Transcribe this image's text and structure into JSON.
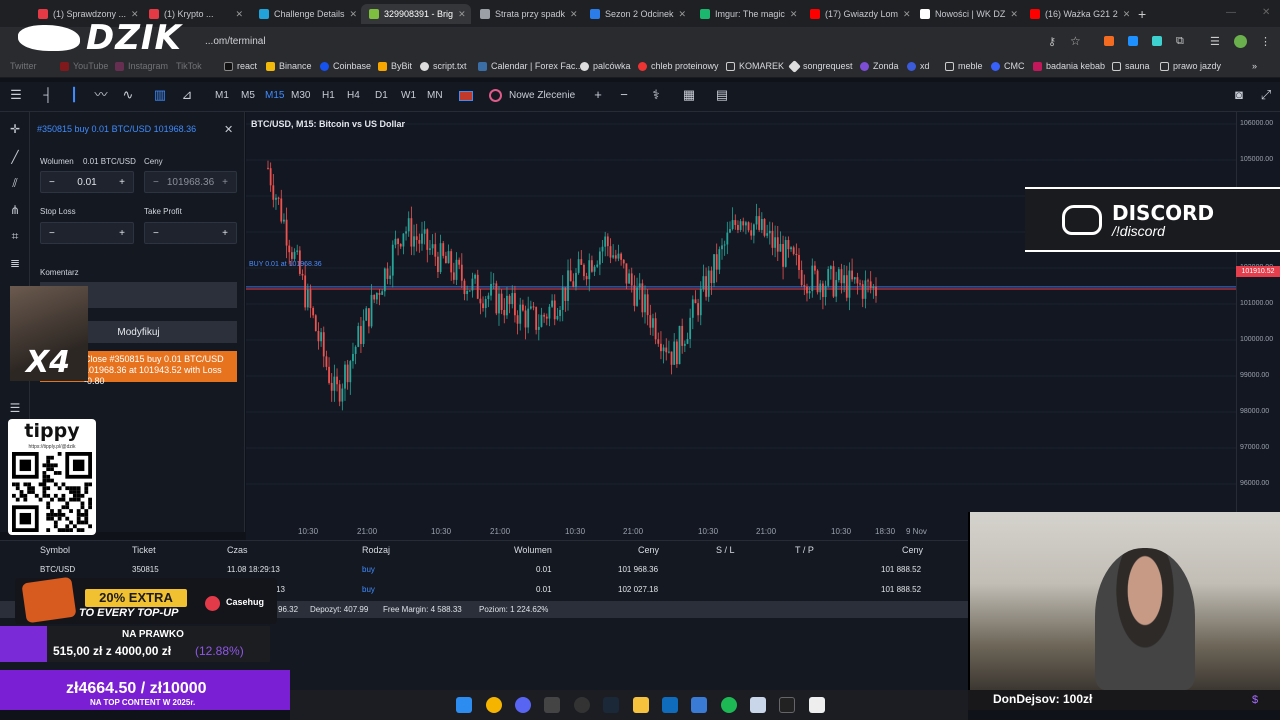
{
  "browser": {
    "tabs": [
      "(1) Sprawdzony ...",
      "(1) Krypto ...",
      "Challenge Details",
      "329908391 - Brig",
      "Strata przy spadk",
      "Sezon 2 Odcinek",
      "Imgur: The magic",
      "(17) Gwiazdy Lom",
      "Nowości | WK DZ",
      "(16) Ważka G21 2"
    ],
    "new_tab": "+",
    "url": "...om/terminal",
    "bookmarks": [
      "Twitter",
      "YouTube",
      "Instagram",
      "TikTok",
      "react",
      "Binance",
      "Coinbase",
      "ByBit",
      "script.txt",
      "Calendar | Forex Fac...",
      "palcówka",
      "chleb proteinowy",
      "KOMAREK",
      "songrequest",
      "Zonda",
      "xd",
      "CMC",
      "meble",
      "badania kebab",
      "sauna",
      "prawo jazdy"
    ],
    "bookmarks_more": "»"
  },
  "overlay_logo": "DZIK",
  "toolbar": {
    "timeframes": [
      "M1",
      "M5",
      "M15",
      "M30",
      "H1",
      "H4",
      "D1",
      "W1",
      "MN"
    ],
    "active_timeframe": "M15",
    "new_order": "Nowe Zlecenie"
  },
  "order_panel": {
    "title": "#350815 buy 0.01 BTC/USD 101968.36",
    "volume_label": "Wolumen",
    "volume_unit": "0.01 BTC/USD",
    "price_label": "Ceny",
    "volume_value": "0.01",
    "price_value": "101968.36",
    "stop_loss_label": "Stop Loss",
    "take_profit_label": "Take Profit",
    "comment_label": "Komentarz",
    "modify_button": "Modyfikuj",
    "close_line1": "Close #350815 buy 0.01 BTC/USD",
    "close_line2": "101968.36 at 101943.52 with Loss -0.80",
    "minus": "−",
    "plus": "+"
  },
  "overlay_multiplier": "X4",
  "tippy": {
    "title": "tippy",
    "url": "https://tipply.pl/@dzik"
  },
  "chart": {
    "title": "BTC/USD, M15: Bitcoin vs US Dollar",
    "buy_line_label": "BUY 0.01 at 101968.36",
    "current_price_tag": "101910.52",
    "price_ticks": [
      "106000.00",
      "105000.00",
      "104000.00",
      "103000.00",
      "102000.00",
      "101000.00",
      "100000.00",
      "99000.00",
      "98000.00",
      "97000.00",
      "96000.00"
    ],
    "time_ticks": [
      "10:30",
      "21:00",
      "10:30",
      "21:00",
      "10:30",
      "21:00",
      "10:30",
      "21:00",
      "10:30",
      "18:30",
      "9 Nov"
    ]
  },
  "chart_data": {
    "type": "line",
    "title": "BTC/USD, M15: Bitcoin vs US Dollar",
    "xlabel": "",
    "ylabel": "",
    "ylim": [
      95500,
      106500
    ],
    "x": [
      "10:30",
      "21:00",
      "10:30",
      "21:00",
      "10:30",
      "21:00",
      "10:30",
      "21:00",
      "10:30",
      "18:30"
    ],
    "series": [
      {
        "values": [
          105200,
          99000,
          103600,
          102000,
          101000,
          103200,
          100100,
          104000,
          102200,
          101910
        ]
      }
    ],
    "reference_line": 101968.36
  },
  "discord": {
    "title": "DISCORD",
    "command": "/!discord"
  },
  "positions": {
    "headers": [
      "Symbol",
      "Ticket",
      "Czas",
      "Rodzaj",
      "Wolumen",
      "Ceny",
      "S / L",
      "T / P",
      "Ceny"
    ],
    "rows": [
      {
        "symbol": "BTC/USD",
        "ticket": "350815",
        "time": "11.08 18:29:13",
        "type": "buy",
        "volume": "0.01",
        "price": "101 968.36",
        "sl": "",
        "tp": "",
        "current": "101 888.52"
      },
      {
        "symbol": "",
        "ticket": "",
        "time": "13",
        "type": "buy",
        "volume": "0.01",
        "price": "102 027.18",
        "sl": "",
        "tp": "",
        "current": "101 888.52"
      }
    ],
    "summary": {
      "balance_tail": "96.32",
      "deposit": "Depozyt: 407.99",
      "free_margin": "Free Margin: 4 588.33",
      "level": "Poziom: 1 224.62%"
    }
  },
  "promo": {
    "badge": "20% EXTRA",
    "sub": "TO EVERY TOP-UP",
    "brand": "Casehug"
  },
  "goal": {
    "heading": "NA PRAWKO",
    "amount": "515,00 zł z 4000,00 zł",
    "percent": "(12.88%)"
  },
  "donation_goal": {
    "amount": "zł4664.50 / zł10000",
    "sub": "NA TOP CONTENT W 2025r."
  },
  "donor": {
    "text": "DonDejsov: 100zł"
  }
}
